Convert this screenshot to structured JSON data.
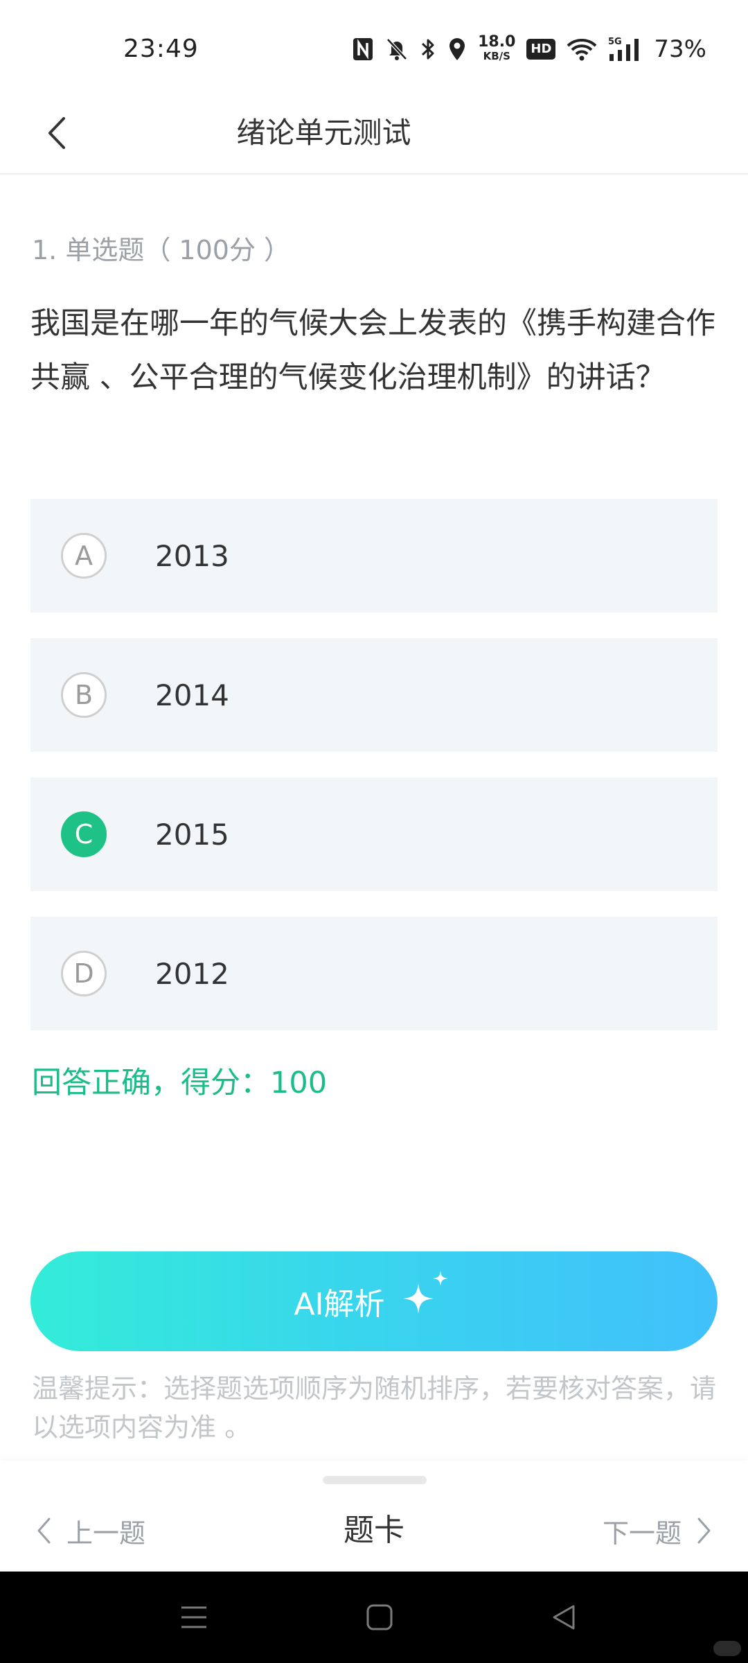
{
  "status_bar": {
    "time": "23:49",
    "icons": [
      "nfc-icon",
      "bell-off-icon",
      "bluetooth-icon",
      "location-icon",
      "network-speed",
      "hd-icon",
      "wifi-icon",
      "signal-5g-icon"
    ],
    "speed_value": "18.0",
    "speed_unit": "KB/S",
    "hd_label": "HD",
    "network_label": "5G",
    "battery": "73%"
  },
  "header": {
    "title": "绪论单元测试",
    "back_icon": "chevron-left-icon"
  },
  "question": {
    "meta": "1. 单选题（ 100分 ）",
    "text": "我国是在哪一年的气候大会上发表的《携手构建合作共赢 、公平合理的气候变化治理机制》的讲话？",
    "options": [
      {
        "letter": "A",
        "text": "2013"
      },
      {
        "letter": "B",
        "text": "2014"
      },
      {
        "letter": "C",
        "text": "2015"
      },
      {
        "letter": "D",
        "text": "2012"
      }
    ],
    "selected": "C",
    "result": "回答正确，得分：100"
  },
  "ai_button": {
    "label": "AI解析",
    "icon": "sparkle-icon"
  },
  "tip": "温馨提示：选择题选项顺序为随机排序，若要核对答案，请以选项内容为准 。",
  "bottom_nav": {
    "prev": "上一题",
    "card": "题卡",
    "next": "下一题"
  },
  "colors": {
    "accent_green": "#1ec186",
    "result_green": "#1cbc8a",
    "ai_gradient_start": "#33ecd8",
    "ai_gradient_end": "#41c0fb",
    "option_bg": "#f3f6f9"
  }
}
